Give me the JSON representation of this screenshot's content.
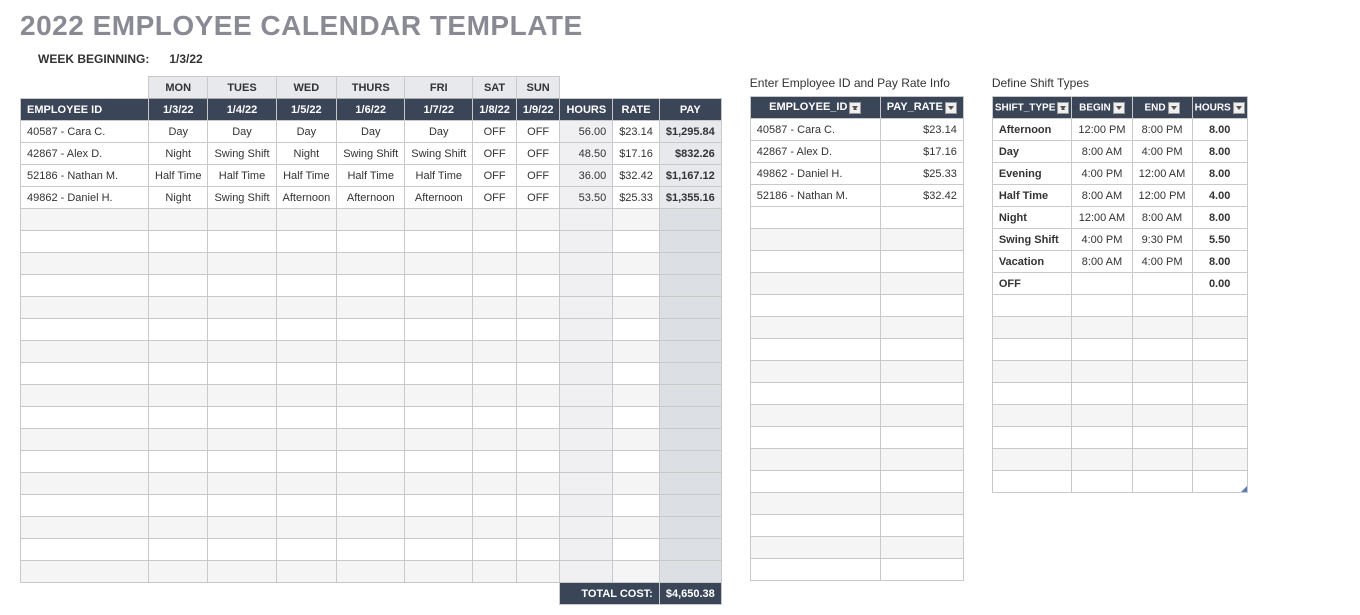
{
  "title": "2022 EMPLOYEE CALENDAR TEMPLATE",
  "week_label": "WEEK BEGINNING:",
  "week_date": "1/3/22",
  "schedule": {
    "day_headers": [
      "MON",
      "TUES",
      "WED",
      "THURS",
      "FRI",
      "SAT",
      "SUN"
    ],
    "col_headers": [
      "EMPLOYEE ID",
      "1/3/22",
      "1/4/22",
      "1/5/22",
      "1/6/22",
      "1/7/22",
      "1/8/22",
      "1/9/22",
      "HOURS",
      "RATE",
      "PAY"
    ],
    "rows": [
      {
        "id": "40587 - Cara C.",
        "d": [
          "Day",
          "Day",
          "Day",
          "Day",
          "Day",
          "OFF",
          "OFF"
        ],
        "hours": "56.00",
        "rate": "$23.14",
        "pay": "$1,295.84"
      },
      {
        "id": "42867 - Alex D.",
        "d": [
          "Night",
          "Swing Shift",
          "Night",
          "Swing Shift",
          "Swing Shift",
          "OFF",
          "OFF"
        ],
        "hours": "48.50",
        "rate": "$17.16",
        "pay": "$832.26"
      },
      {
        "id": "52186 - Nathan M.",
        "d": [
          "Half Time",
          "Half Time",
          "Half Time",
          "Half Time",
          "Half Time",
          "OFF",
          "OFF"
        ],
        "hours": "36.00",
        "rate": "$32.42",
        "pay": "$1,167.12"
      },
      {
        "id": "49862 - Daniel H.",
        "d": [
          "Night",
          "Swing Shift",
          "Afternoon",
          "Afternoon",
          "Afternoon",
          "OFF",
          "OFF"
        ],
        "hours": "53.50",
        "rate": "$25.33",
        "pay": "$1,355.16"
      }
    ],
    "total_label": "TOTAL COST:",
    "total_value": "$4,650.38",
    "blank_rows": 17
  },
  "payrate": {
    "label": "Enter Employee ID and Pay Rate Info",
    "headers": [
      "EMPLOYEE_ID",
      "PAY_RATE"
    ],
    "rows": [
      {
        "id": "40587 - Cara C.",
        "rate": "$23.14"
      },
      {
        "id": "42867 - Alex D.",
        "rate": "$17.16"
      },
      {
        "id": "49862 - Daniel H.",
        "rate": "$25.33"
      },
      {
        "id": "52186 - Nathan M.",
        "rate": "$32.42"
      }
    ],
    "blank_rows": 17
  },
  "shifts": {
    "label": "Define Shift Types",
    "headers": [
      "SHIFT_TYPE",
      "BEGIN",
      "END",
      "HOURS"
    ],
    "rows": [
      {
        "t": "Afternoon",
        "b": "12:00 PM",
        "e": "8:00 PM",
        "h": "8.00"
      },
      {
        "t": "Day",
        "b": "8:00 AM",
        "e": "4:00 PM",
        "h": "8.00"
      },
      {
        "t": "Evening",
        "b": "4:00 PM",
        "e": "12:00 AM",
        "h": "8.00"
      },
      {
        "t": "Half Time",
        "b": "8:00 AM",
        "e": "12:00 PM",
        "h": "4.00"
      },
      {
        "t": "Night",
        "b": "12:00 AM",
        "e": "8:00 AM",
        "h": "8.00"
      },
      {
        "t": "Swing Shift",
        "b": "4:00 PM",
        "e": "9:30 PM",
        "h": "5.50"
      },
      {
        "t": "Vacation",
        "b": "8:00 AM",
        "e": "4:00 PM",
        "h": "8.00"
      },
      {
        "t": "OFF",
        "b": "",
        "e": "",
        "h": "0.00"
      }
    ],
    "blank_rows": 9
  }
}
